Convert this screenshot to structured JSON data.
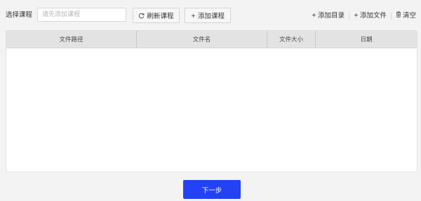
{
  "toolbar": {
    "course_label": "选择课程",
    "course_placeholder": "请先添加课程",
    "refresh_label": "刷新课程",
    "add_course_label": "添加课程",
    "add_dir_label": "添加目录",
    "add_file_label": "添加文件",
    "clear_label": "清空"
  },
  "table": {
    "columns": [
      "文件路径",
      "文件名",
      "文件大小",
      "日期"
    ],
    "rows": []
  },
  "footer": {
    "next_label": "下一步"
  },
  "colors": {
    "primary": "#2342f5",
    "header_bg": "#e3e3e3",
    "page_bg": "#f3f3f3"
  },
  "icons": {
    "refresh": "refresh-icon",
    "plus": "plus-icon",
    "trash": "trash-icon"
  }
}
